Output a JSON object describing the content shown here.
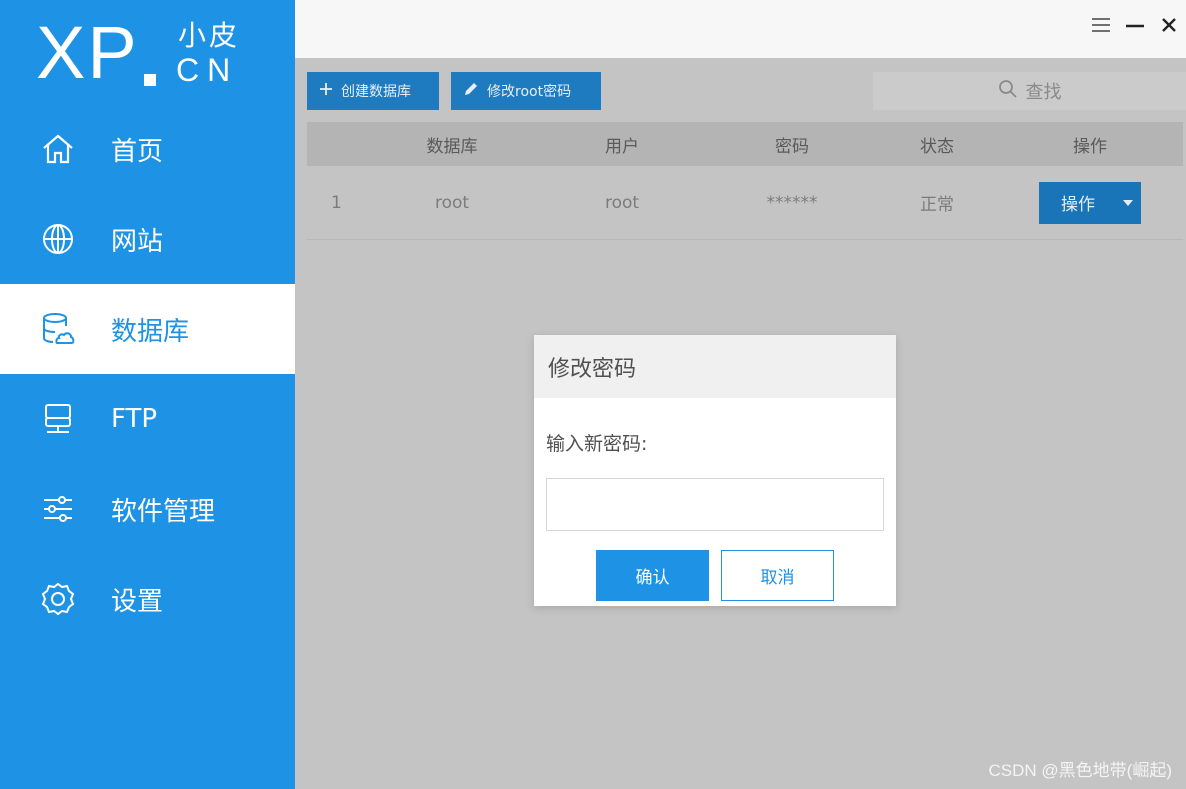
{
  "logo": {
    "xp": "XP",
    "cn_zh": "小皮",
    "cn_en": "CN"
  },
  "sidebar": {
    "items": [
      {
        "label": "首页",
        "icon": "home-icon",
        "active": false
      },
      {
        "label": "网站",
        "icon": "globe-icon",
        "active": false
      },
      {
        "label": "数据库",
        "icon": "database-icon",
        "active": true
      },
      {
        "label": "FTP",
        "icon": "server-icon",
        "active": false
      },
      {
        "label": "软件管理",
        "icon": "sliders-icon",
        "active": false
      },
      {
        "label": "设置",
        "icon": "gear-icon",
        "active": false
      }
    ]
  },
  "window_controls": {
    "menu": "menu-icon",
    "minimize": "minimize-icon",
    "close": "close-icon"
  },
  "toolbar": {
    "create_label": "创建数据库",
    "modify_label": "修改root密码",
    "search_label": "查找"
  },
  "table": {
    "headers": [
      "",
      "数据库",
      "用户",
      "密码",
      "状态",
      "操作"
    ],
    "rows": [
      {
        "index": "1",
        "database": "root",
        "user": "root",
        "password": "******",
        "status": "正常",
        "action": "操作"
      }
    ]
  },
  "modal": {
    "title": "修改密码",
    "label": "输入新密码:",
    "input_value": "",
    "confirm_label": "确认",
    "cancel_label": "取消"
  },
  "watermark": "CSDN @黑色地带(崛起)",
  "colors": {
    "brand": "#1e92e4",
    "overlay": "#c4c4c4",
    "button_dark": "#1e7bc0"
  }
}
